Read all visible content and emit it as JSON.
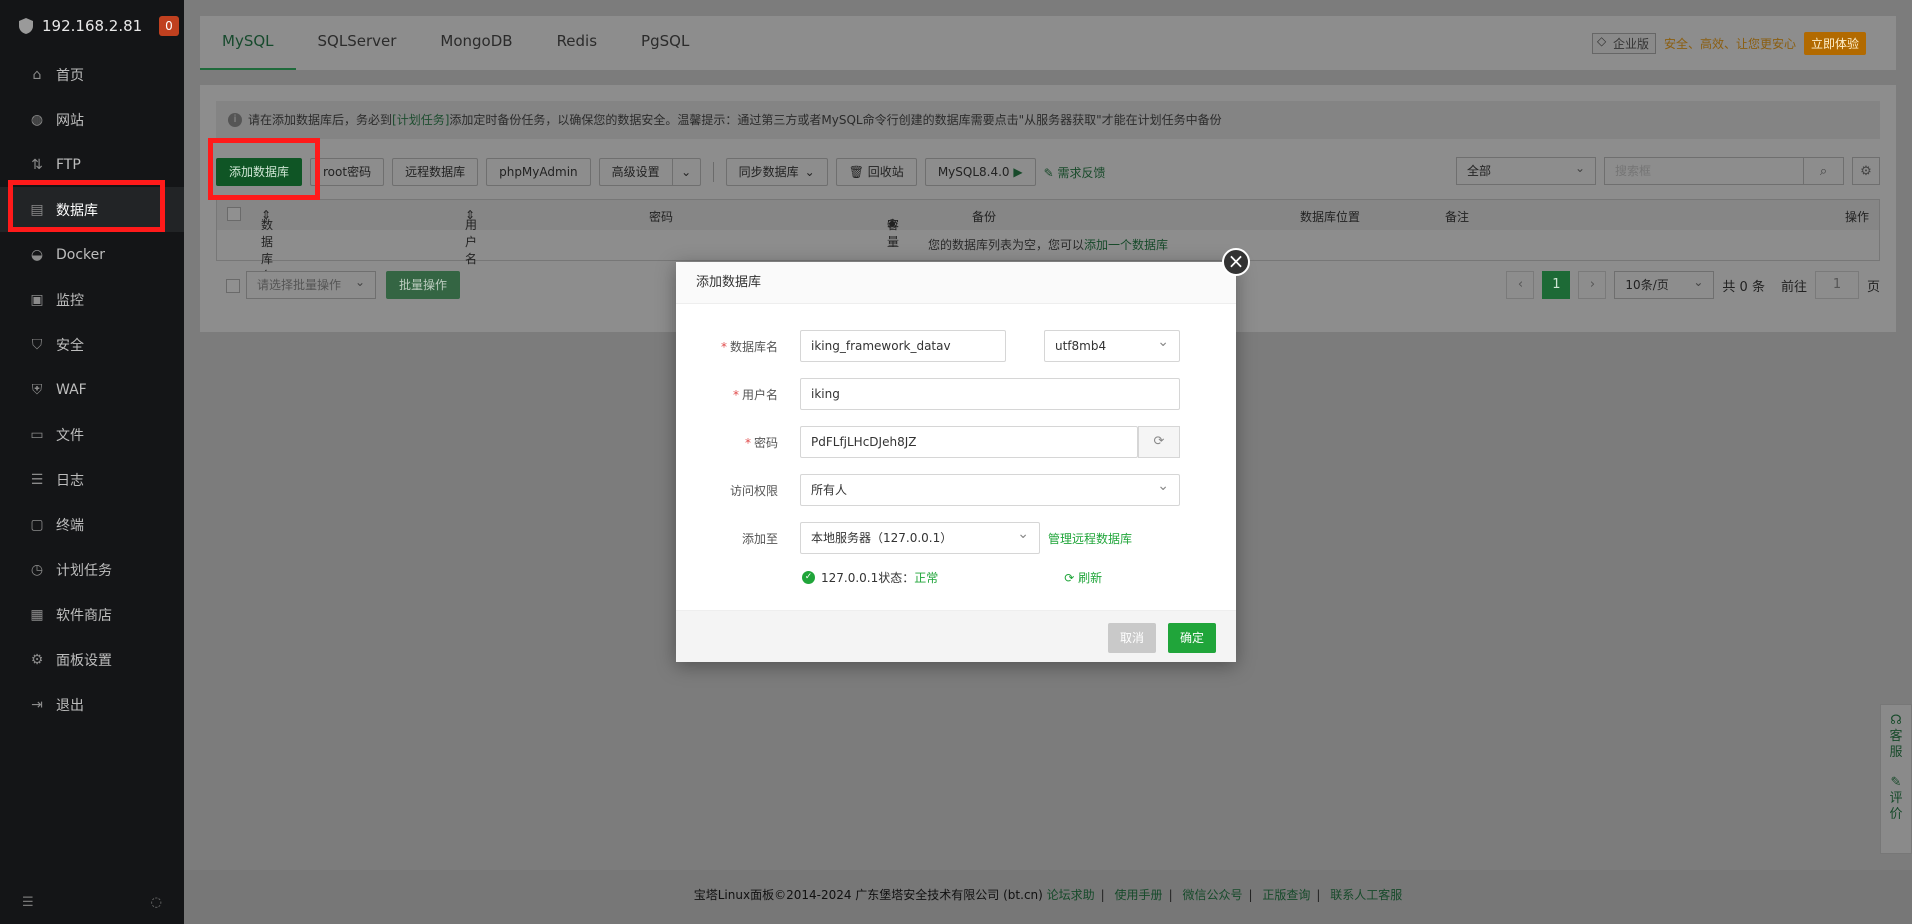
{
  "sidebar": {
    "host": "192.168.2.81",
    "badge": "0",
    "items": [
      {
        "label": "首页",
        "icon": "home-icon"
      },
      {
        "label": "网站",
        "icon": "globe-icon"
      },
      {
        "label": "FTP",
        "icon": "ftp-icon"
      },
      {
        "label": "数据库",
        "icon": "database-icon"
      },
      {
        "label": "Docker",
        "icon": "docker-icon"
      },
      {
        "label": "监控",
        "icon": "monitor-icon"
      },
      {
        "label": "安全",
        "icon": "shield-icon"
      },
      {
        "label": "WAF",
        "icon": "waf-icon"
      },
      {
        "label": "文件",
        "icon": "folder-icon"
      },
      {
        "label": "日志",
        "icon": "log-icon"
      },
      {
        "label": "终端",
        "icon": "terminal-icon"
      },
      {
        "label": "计划任务",
        "icon": "clock-icon"
      },
      {
        "label": "软件商店",
        "icon": "grid-icon"
      },
      {
        "label": "面板设置",
        "icon": "gear-icon"
      },
      {
        "label": "退出",
        "icon": "logout-icon"
      }
    ],
    "active_index": 3
  },
  "tabs": [
    "MySQL",
    "SQLServer",
    "MongoDB",
    "Redis",
    "PgSQL"
  ],
  "enterprise": {
    "tag": "企业版",
    "slogan": "安全、高效、让您更安心",
    "try_label": "立即体验"
  },
  "tip": {
    "pre": "请在添加数据库后，务必到",
    "link": "[计划任务]",
    "post": "添加定时备份任务，以确保您的数据安全。温馨提示：通过第三方或者MySQL命令行创建的数据库需要点击\"从服务器获取\"才能在计划任务中备份"
  },
  "toolbar": {
    "add_db": "添加数据库",
    "root_pwd": "root密码",
    "remote_db": "远程数据库",
    "phpmyadmin": "phpMyAdmin",
    "advanced": "高级设置",
    "sync_db": "同步数据库",
    "recycle": "回收站",
    "mysql_version": "MySQL8.4.0",
    "feedback": "需求反馈",
    "filter_value": "全部",
    "search_placeholder": "搜索框"
  },
  "table": {
    "columns": [
      "数据库名",
      "用户名",
      "密码",
      "容量",
      "备份",
      "数据库位置",
      "备注",
      "操作"
    ],
    "empty_pre": "您的数据库列表为空，您可以",
    "empty_link": "添加一个数据库"
  },
  "bulk": {
    "select_placeholder": "请选择批量操作",
    "action": "批量操作"
  },
  "pager": {
    "current": "1",
    "per_page": "10条/页",
    "total": "共 0 条",
    "goto_label": "前往",
    "goto_value": "1",
    "page_suffix": "页"
  },
  "modal": {
    "title": "添加数据库",
    "db_name_label": "数据库名",
    "db_name_value": "iking_framework_datav",
    "charset": "utf8mb4",
    "user_label": "用户名",
    "user_value": "iking",
    "pwd_label": "密码",
    "pwd_value": "PdFLfjLHcDJeh8JZ",
    "access_label": "访问权限",
    "access_value": "所有人",
    "add_to_label": "添加至",
    "add_to_value": "本地服务器（127.0.0.1）",
    "manage_remote": "管理远程数据库",
    "status_pre": "127.0.0.1状态：",
    "status_value": "正常",
    "refresh": "刷新",
    "cancel": "取消",
    "confirm": "确定"
  },
  "footer": {
    "copyright": "宝塔Linux面板©2014-2024 广东堡塔安全技术有限公司 (bt.cn)",
    "links": [
      "论坛求助",
      "使用手册",
      "微信公众号",
      "正版查询",
      "联系人工客服"
    ]
  },
  "service": {
    "kefu": [
      "客",
      "服"
    ],
    "pingjia": [
      "评",
      "价"
    ]
  },
  "colors": {
    "accent": "#20a53a",
    "highlight": "#ff1a1a"
  }
}
